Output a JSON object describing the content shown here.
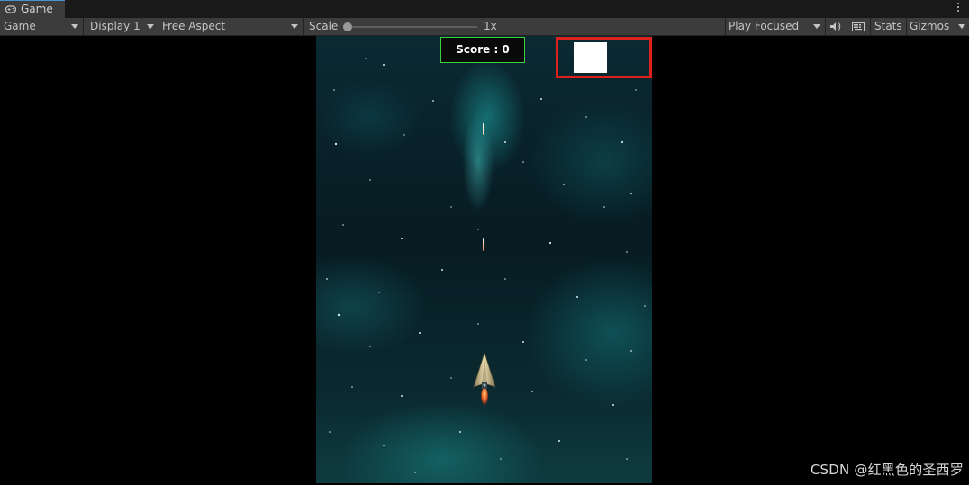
{
  "tab": {
    "label": "Game",
    "icon": "gamepad-icon"
  },
  "toolbar": {
    "view_select": "Game",
    "display_select": "Display 1",
    "aspect_select": "Free Aspect",
    "scale_label": "Scale",
    "scale_value": "1x",
    "play_mode_select": "Play Focused",
    "audio_icon": "speaker-icon",
    "keyboard_icon": "keyboard-icon",
    "stats_label": "Stats",
    "gizmos_label": "Gizmos"
  },
  "game": {
    "score_text": "Score : 0"
  },
  "colors": {
    "score_border": "#3bd23b",
    "highlight": "#e0201c",
    "toolbar_bg": "#3c3c3c"
  },
  "watermark": "CSDN @红黑色的圣西罗"
}
